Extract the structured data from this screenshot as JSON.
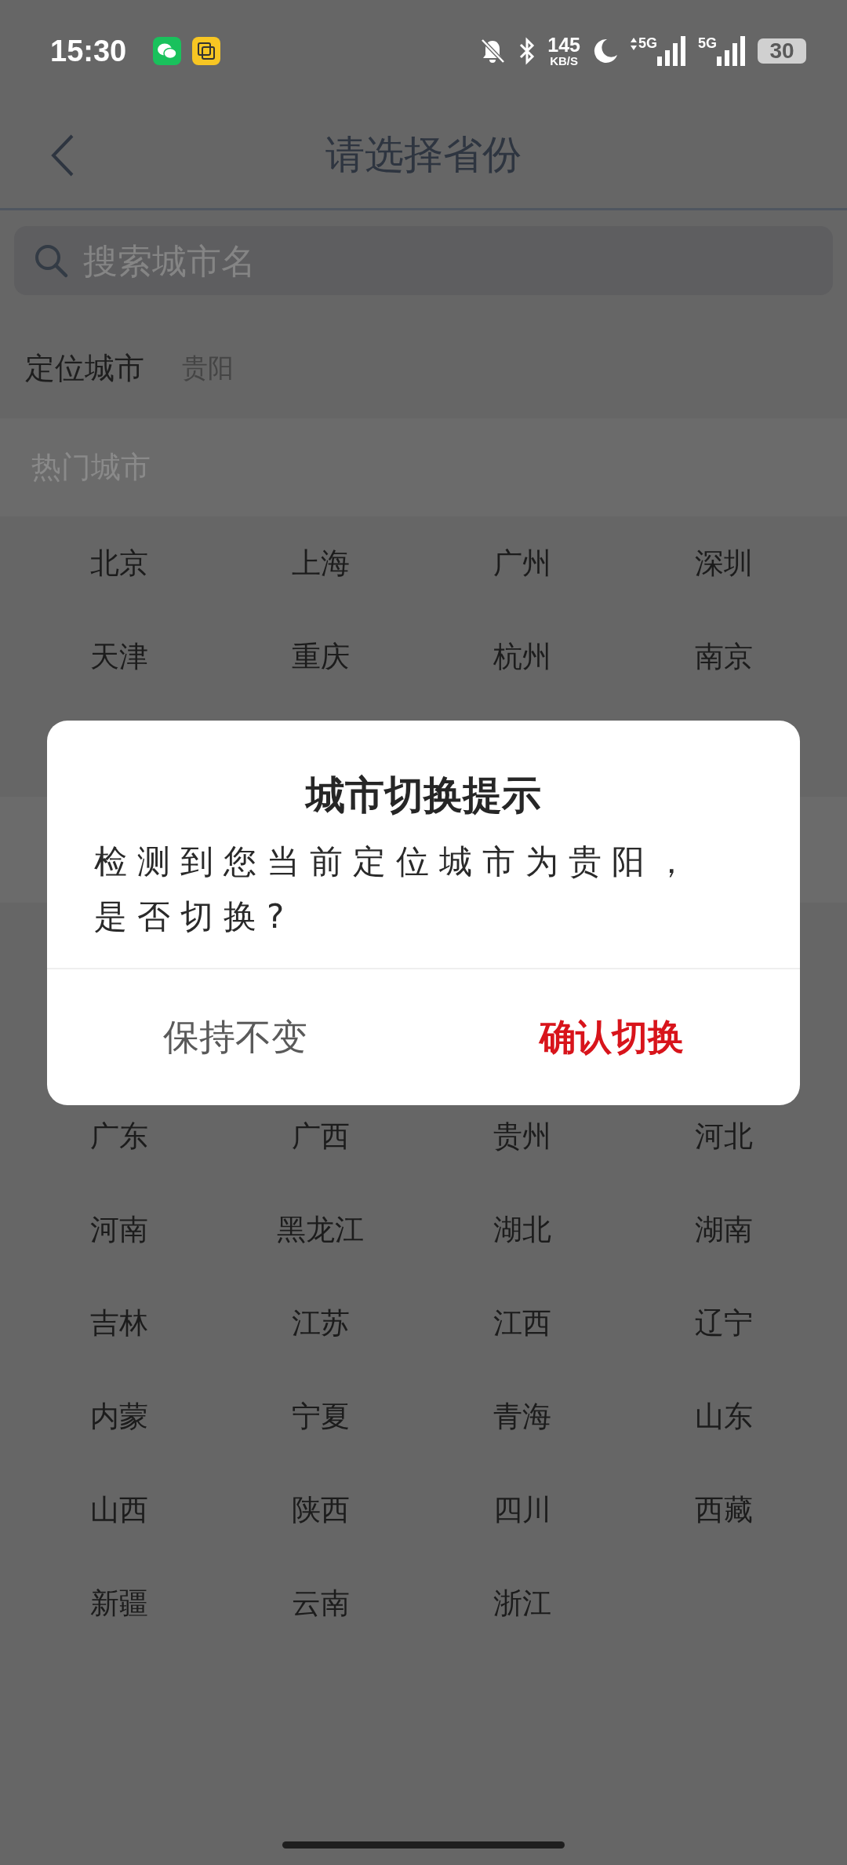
{
  "status_bar": {
    "time": "15:30",
    "network_speed": "145",
    "network_speed_unit": "KB/S",
    "signal_labels": [
      "5G",
      "5G"
    ],
    "battery": "30"
  },
  "header": {
    "title": "请选择省份"
  },
  "search": {
    "placeholder": "搜索城市名"
  },
  "location": {
    "label": "定位城市",
    "city": "贵阳"
  },
  "hot_cities": {
    "title": "热门城市",
    "items": [
      "北京",
      "上海",
      "广州",
      "深圳",
      "天津",
      "重庆",
      "杭州",
      "南京"
    ]
  },
  "provinces": {
    "items": [
      "广东",
      "广西",
      "贵州",
      "河北",
      "河南",
      "黑龙江",
      "湖北",
      "湖南",
      "吉林",
      "江苏",
      "江西",
      "辽宁",
      "内蒙",
      "宁夏",
      "青海",
      "山东",
      "山西",
      "陕西",
      "四川",
      "西藏",
      "新疆",
      "云南",
      "浙江"
    ]
  },
  "dialog": {
    "title": "城市切换提示",
    "message": "检测到您当前定位城市为贵阳，是否切换?",
    "buttons": [
      {
        "label": "保持不变",
        "kind": "cancel"
      },
      {
        "label": "确认切换",
        "kind": "confirm"
      }
    ]
  }
}
